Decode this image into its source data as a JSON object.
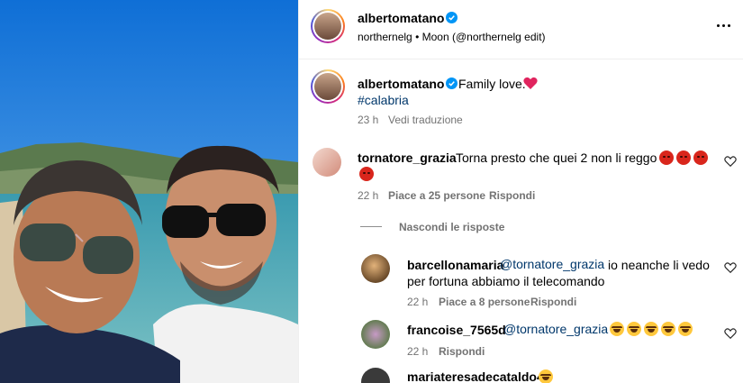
{
  "header": {
    "username": "albertomatano",
    "music_artist": "northernelg",
    "music_separator": "•",
    "music_track": "Moon (@northernelg edit)",
    "more_icon": "more-horizontal-icon"
  },
  "caption": {
    "username": "albertomatano",
    "text": "Family love.",
    "emoji": "red-heart",
    "hashtag": "#calabria",
    "time": "23 h",
    "translate": "Vedi traduzione"
  },
  "comments": [
    {
      "username": "tornatore_grazia",
      "text": "Torna presto che quei 2 non li reggo",
      "emoji": "angry-face",
      "emoji_count": 4,
      "time": "22 h",
      "likes": "Piace a 25 persone",
      "reply": "Rispondi",
      "hide_replies": "Nascondi le risposte",
      "replies": [
        {
          "username": "barcellonamaria",
          "mention": "@tornatore_grazia",
          "text_line1": "io neanche li vedo",
          "text_line2": "per fortuna abbiamo il telecomando",
          "time": "22 h",
          "likes": "Piace a 8 persone",
          "reply": "Rispondi"
        },
        {
          "username": "francoise_7565d",
          "mention": "@tornatore_grazia",
          "emoji": "face-with-tears-of-joy",
          "emoji_count": 5,
          "time": "22 h",
          "reply": "Rispondi"
        },
        {
          "username": "mariateresadecataldo4",
          "emoji": "face-with-tears-of-joy"
        }
      ]
    }
  ],
  "colors": {
    "link": "#00376b",
    "muted": "#737373",
    "verified": "#0095f6",
    "heart": "#e0245e"
  }
}
